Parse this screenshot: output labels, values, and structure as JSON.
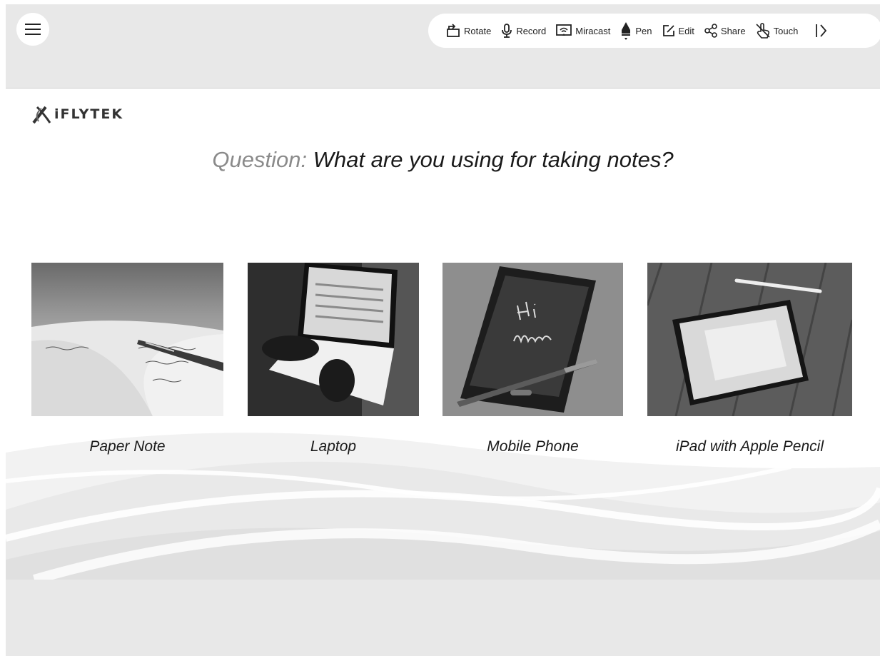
{
  "toolbar": {
    "items": [
      {
        "label": "Rotate",
        "icon": "rotate-icon"
      },
      {
        "label": "Record",
        "icon": "microphone-icon"
      },
      {
        "label": "Miracast",
        "icon": "miracast-icon"
      },
      {
        "label": "Pen",
        "icon": "pen-icon"
      },
      {
        "label": "Edit",
        "icon": "edit-icon"
      },
      {
        "label": "Share",
        "icon": "share-icon"
      },
      {
        "label": "Touch",
        "icon": "touch-icon"
      }
    ]
  },
  "slide": {
    "logo": "iFLYTEK",
    "question_prefix": "Question:",
    "question_text": " What are you using for taking notes?",
    "cards": [
      {
        "label": "Paper Note",
        "image": "notebook-pen-photo"
      },
      {
        "label": "Laptop",
        "image": "laptop-typing-photo"
      },
      {
        "label": "Mobile Phone",
        "image": "phone-stylus-photo"
      },
      {
        "label": "iPad with Apple Pencil",
        "image": "tablet-pencil-photo"
      }
    ]
  },
  "colors": {
    "chrome_background": "#e8e8e8",
    "slide_background": "#ffffff"
  }
}
